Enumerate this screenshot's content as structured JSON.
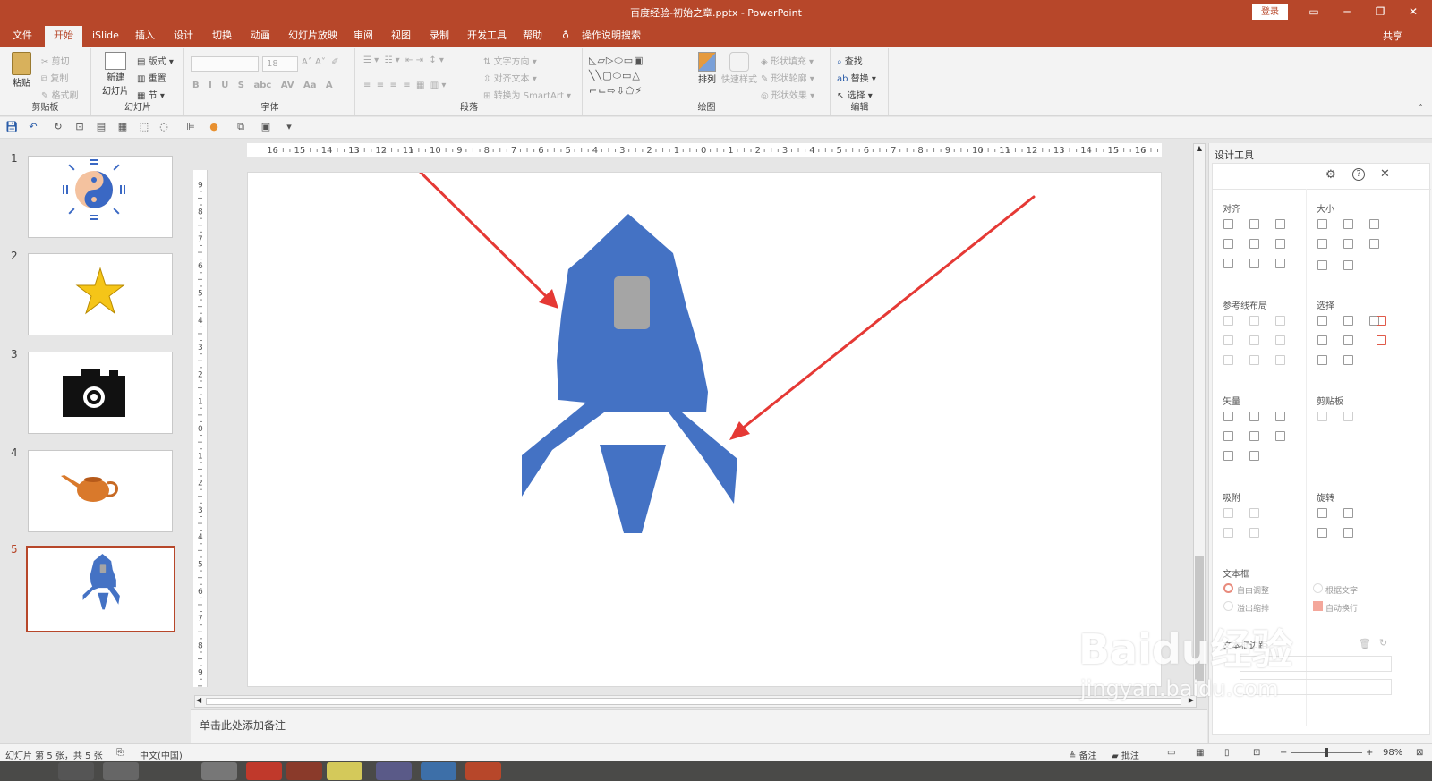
{
  "window": {
    "title": "百度经验-初始之章.pptx  -  PowerPoint",
    "login": "登录"
  },
  "tabs": [
    "文件",
    "开始",
    "iSlide",
    "插入",
    "设计",
    "切换",
    "动画",
    "幻灯片放映",
    "审阅",
    "视图",
    "录制",
    "开发工具",
    "帮助"
  ],
  "tell_me": "操作说明搜索",
  "share": "共享",
  "ribbon": {
    "clipboard": {
      "paste": "粘贴",
      "cut": "剪切",
      "copy": "复制",
      "format": "格式刷",
      "label": "剪贴板"
    },
    "slides": {
      "new": "新建",
      "new2": "幻灯片",
      "layout": "版式",
      "reset": "重置",
      "section": "节",
      "label": "幻灯片"
    },
    "font": {
      "size": "18",
      "label": "字体"
    },
    "paragraph": {
      "text_dir": "文字方向",
      "align_text": "对齐文本",
      "smartart": "转换为 SmartArt",
      "label": "段落"
    },
    "drawing": {
      "arrange": "排列",
      "quick_styles": "快速样式",
      "fill": "形状填充",
      "outline": "形状轮廓",
      "effects": "形状效果",
      "label": "绘图"
    },
    "editing": {
      "find": "查找",
      "replace": "替换",
      "select": "选择",
      "label": "编辑"
    }
  },
  "slides": [
    {
      "num": "1",
      "name": "yinyang"
    },
    {
      "num": "2",
      "name": "star"
    },
    {
      "num": "3",
      "name": "camera"
    },
    {
      "num": "4",
      "name": "teapot"
    },
    {
      "num": "5",
      "name": "rocket"
    }
  ],
  "notes_placeholder": "单击此处添加备注",
  "pane": {
    "title": "设计工具",
    "sections": {
      "align": "对齐",
      "size": "大小",
      "guide": "参考线布局",
      "select": "选择",
      "vector": "矢量",
      "clipboard": "剪贴板",
      "snap": "吸附",
      "rotate": "旋转",
      "textbox": "文本框",
      "margin": "文本框边距"
    },
    "options": {
      "auto_adjust": "自由调整",
      "fit_text": "根据文字",
      "overflow": "溢出缩排",
      "wrap": "自动换行"
    }
  },
  "status": {
    "slide_info": "幻灯片 第 5 张，共 5 张",
    "lang": "中文(中国)",
    "notes": "备注",
    "comments": "批注",
    "zoom": "98%"
  },
  "watermark": {
    "brand": "Baidu经验",
    "url": "jingyan.baidu.com"
  },
  "colors": {
    "accent": "#b7472a",
    "rocket": "#4472c4",
    "window": "#a5a5a5",
    "arrow": "#e53935"
  }
}
